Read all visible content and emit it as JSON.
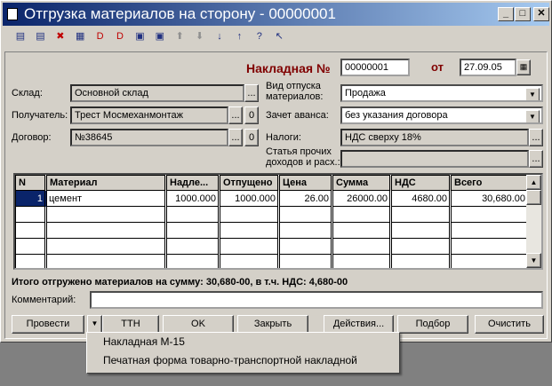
{
  "window": {
    "title": "Отгрузка материалов на сторону - 00000001",
    "controls": {
      "minimize": "_",
      "maximize": "□",
      "close": "✕"
    }
  },
  "toolbar": [
    "new-icon",
    "add-icon",
    "delete-icon",
    "copy-icon",
    "doc-delete-icon",
    "dk-icon",
    "insert-icon",
    "insert2-icon",
    "up-arrow-icon",
    "down-arrow-icon",
    "sort-asc-icon",
    "sort-desc-icon",
    "help-icon",
    "whats-this-icon"
  ],
  "header": {
    "invoice_label": "Накладная №",
    "invoice_number": "00000001",
    "date_label": "от",
    "date": "27.09.05"
  },
  "fields": {
    "sklad_label": "Склад:",
    "sklad_value": "Основной склад",
    "poluchatel_label": "Получатель:",
    "poluchatel_value": "Трест Мосмеханмонтаж",
    "dogovor_label": "Договор:",
    "dogovor_value": "№38645",
    "vid_label": "Вид отпуска материалов:",
    "vid_value": "Продажа",
    "zachet_label": "Зачет аванса:",
    "zachet_value": "без указания договора",
    "nalogi_label": "Налоги:",
    "nalogi_value": "НДС сверху 18%",
    "statya_label": "Статья прочих доходов и расх.:",
    "statya_value": "",
    "zero": "0",
    "dots": "..."
  },
  "table": {
    "columns": [
      "N",
      "Материал",
      "Надле...",
      "Отпущено",
      "Цена",
      "Сумма",
      "НДС",
      "Всего"
    ],
    "rows": [
      [
        "1",
        "цемент",
        "1000.000",
        "1000.000",
        "26.00",
        "26000.00",
        "4680.00",
        "30,680.00"
      ]
    ]
  },
  "total_text": "Итого отгружено материалов на сумму: 30,680-00, в т.ч. НДС: 4,680-00",
  "comment": {
    "label": "Комментарий:",
    "value": ""
  },
  "buttons": {
    "provesti": "Провести",
    "ttn": "ТТН",
    "ok": "OK",
    "zakryt": "Закрыть",
    "deistviya": "Действия...",
    "podbor": "Подбор",
    "ochistit": "Очистить"
  },
  "menu": [
    "Накладная М-15",
    "Печатная форма товарно-транспортной накладной"
  ]
}
